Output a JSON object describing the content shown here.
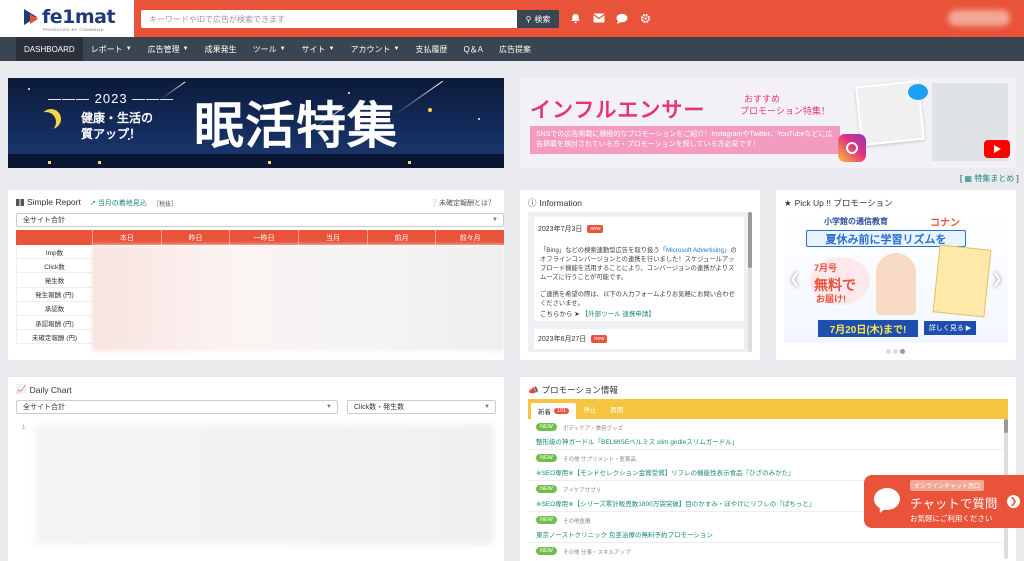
{
  "header": {
    "logo_text": "fe1mat",
    "logo_sub": "PRODUCED BY COMMAND",
    "search_placeholder": "キーワードやIDで広告が検索できます",
    "search_button": "検索",
    "icons": [
      "bell-icon",
      "mail-icon",
      "chat-icon",
      "gear-icon"
    ],
    "brand_color": "#e8533a"
  },
  "nav": {
    "items": [
      {
        "label": "DASHBOARD",
        "dropdown": false
      },
      {
        "label": "レポート",
        "dropdown": true
      },
      {
        "label": "広告管理",
        "dropdown": true
      },
      {
        "label": "成果発生",
        "dropdown": false
      },
      {
        "label": "ツール",
        "dropdown": true
      },
      {
        "label": "サイト",
        "dropdown": true
      },
      {
        "label": "アカウント",
        "dropdown": true
      },
      {
        "label": "支払履歴",
        "dropdown": false
      },
      {
        "label": "Q＆A",
        "dropdown": false
      },
      {
        "label": "広告提案",
        "dropdown": false
      }
    ]
  },
  "banners": {
    "left": {
      "year": "2023",
      "line1": "健康・生活の",
      "line2": "質アップ！",
      "big": "眠活特集"
    },
    "right": {
      "title": "インフルエンサー",
      "rec1": "おすすめ",
      "rec2": "プロモーション特集！",
      "desc": "SNSでの広告掲載に積極的なプロモーションをご紹介！InstagramやTwitter、YouTubeなどに広告掲載を検討されている方・プロモーションを探している方必見です！"
    },
    "feature_link": "特集まとめ"
  },
  "simple_report": {
    "title": "Simple Report",
    "link": "当月の着地見込",
    "note": "［税抜］",
    "help": "未確定報酬とは？",
    "site_select": "全サイト合計",
    "columns": [
      "本日",
      "昨日",
      "一昨日",
      "当月",
      "前月",
      "前々月"
    ],
    "rows": [
      "Imp数",
      "Click数",
      "発生数",
      "発生報酬 (円)",
      "承認数",
      "承認報酬 (円)",
      "未確定報酬 (円)"
    ]
  },
  "information": {
    "title": "Information",
    "items": [
      {
        "date": "2023年7月3日",
        "badge": "new",
        "text_before": "「Bing」などの検索連動型広告を取り扱う「",
        "highlight": "Microsoft Advertising",
        "text_after": "」のオフラインコンバージョンとの連携を行いました！スケジュールアップロード機能を活用することにより、コンバージョンの連携がよりスムーズに行うことが可能です。",
        "text2": "ご連携を希望の際は、以下の入力フォームよりお気軽にお問い合わせくださいませ。",
        "link_prefix": "こちらから",
        "link": "【外部ツール 連携申請】"
      },
      {
        "date": "2023年6月27日",
        "badge": "new"
      }
    ]
  },
  "pickup": {
    "title": "Pick Up !! プロモーション",
    "top_text": "小学館の通信教育",
    "brand": "コナン",
    "bar_text": "夏休み前に学習リズムを",
    "promo1": "7月号",
    "promo2": "無料で",
    "promo3": "お届け!",
    "date_text": "7月20日(木)まで!",
    "more": "詳しく見る ▶"
  },
  "daily_chart": {
    "title": "Daily Chart",
    "site_select": "全サイト合計",
    "metric_select": "Click数・発生数",
    "axis_label": "1"
  },
  "promotion_info": {
    "title": "プロモーション情報",
    "tabs": [
      {
        "label": "新着",
        "count": "101"
      },
      {
        "label": "停止"
      },
      {
        "label": "再開"
      }
    ],
    "items": [
      {
        "badge": "NEW",
        "category": "ボディケア・美容グッズ",
        "name": "整形級の神ガードル「BELMISEベルミス slim girdleスリムガードル」"
      },
      {
        "badge": "NEW",
        "category": "その他 サプリメント・医薬品",
        "name": "※SEO専用※【モンドセレクション金賞受賞】リフレの機能性表示食品『ひざのみかた』"
      },
      {
        "badge": "NEW",
        "category": "アイケアサプリ",
        "name": "※SEO専用※【シリーズ累計販売数1800万袋突破】目のかすみ・ぼやけにリフレの『ぱちっと』"
      },
      {
        "badge": "NEW",
        "category": "その他医療",
        "name": "東京ノーストクリニック 包茎治療の無料予約プロモーション"
      },
      {
        "badge": "NEW",
        "category": "その他 仕事・スキルアップ",
        "name": ""
      }
    ]
  },
  "chat_widget": {
    "tag": "オンラインチャット窓口",
    "main": "チャットで質問",
    "sub": "お気軽にご利用ください"
  }
}
